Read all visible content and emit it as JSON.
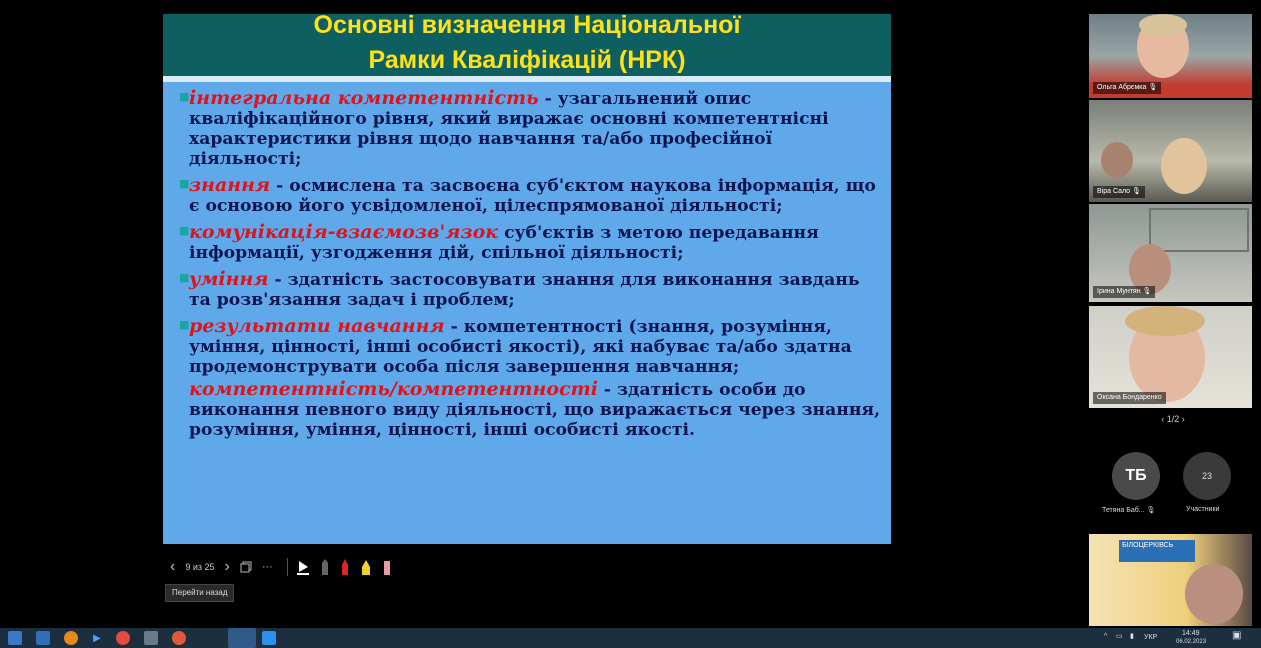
{
  "slide": {
    "title_line1": "Основні визначення Національної",
    "title_line2": "Рамки Кваліфікацій (НРК)",
    "items": [
      {
        "term": "інтегральна компетентність",
        "text": " - узагальнений опис кваліфікаційного рівня, який виражає основні компетентнісні характеристики рівня щодо навчання та/або професійної діяльності;"
      },
      {
        "term": "знання",
        "text": " - осмислена та засвоєна суб'єктом наукова інформація, що є основою його усвідомленої, цілеспрямованої діяльності;"
      },
      {
        "term": " комунікація-взаємозв'язок",
        "text": " суб'єктів з метою передавання інформації, узгодження дій, спільної діяльності;"
      },
      {
        "term": "уміння",
        "text": " - здатність застосовувати знання для виконання завдань та розв'язання задач і проблем;"
      },
      {
        "term": "результати навчання",
        "text": " - компетентності (знання, розуміння, уміння, цінності, інші особисті якості), які набуває та/або здатна продемонструвати особа після завершення навчання;"
      },
      {
        "term": "компетентність/компетентності",
        "text": " - здатність особи до виконання певного виду діяльності, що виражається через знання, розуміння, уміння, цінності, інші особисті якості."
      }
    ]
  },
  "controls": {
    "prev_glyph": "‹",
    "page": "9 из 25",
    "next_glyph": "›",
    "more_glyph": "···",
    "tooltip": "Перейти назад"
  },
  "participants": {
    "tiles": [
      {
        "name": "Ольга Абрємка",
        "mic": "🎙"
      },
      {
        "name": "Віра Сало",
        "mic": "🎙"
      },
      {
        "name": "Ірина Мунтян",
        "mic": "🎙"
      },
      {
        "name": "Оксана Бондаренко",
        "mic": ""
      }
    ],
    "pager": "‹  1/2  ›",
    "avatar_initials": "ТБ",
    "avatar_label": "Тетяна Баб...",
    "count": "23",
    "count_label": "Участники",
    "shared_screen_text": "БІЛОЦЕРКІВСЬ"
  },
  "taskbar": {
    "lang": "УКР",
    "time": "14:49",
    "date": "06.02.2023"
  },
  "colors": {
    "slide_bg": "#5fa8ea",
    "header_bg": "#0e5f5f",
    "title": "#ffe11a",
    "term": "#e0131a",
    "body": "#0a1550"
  }
}
